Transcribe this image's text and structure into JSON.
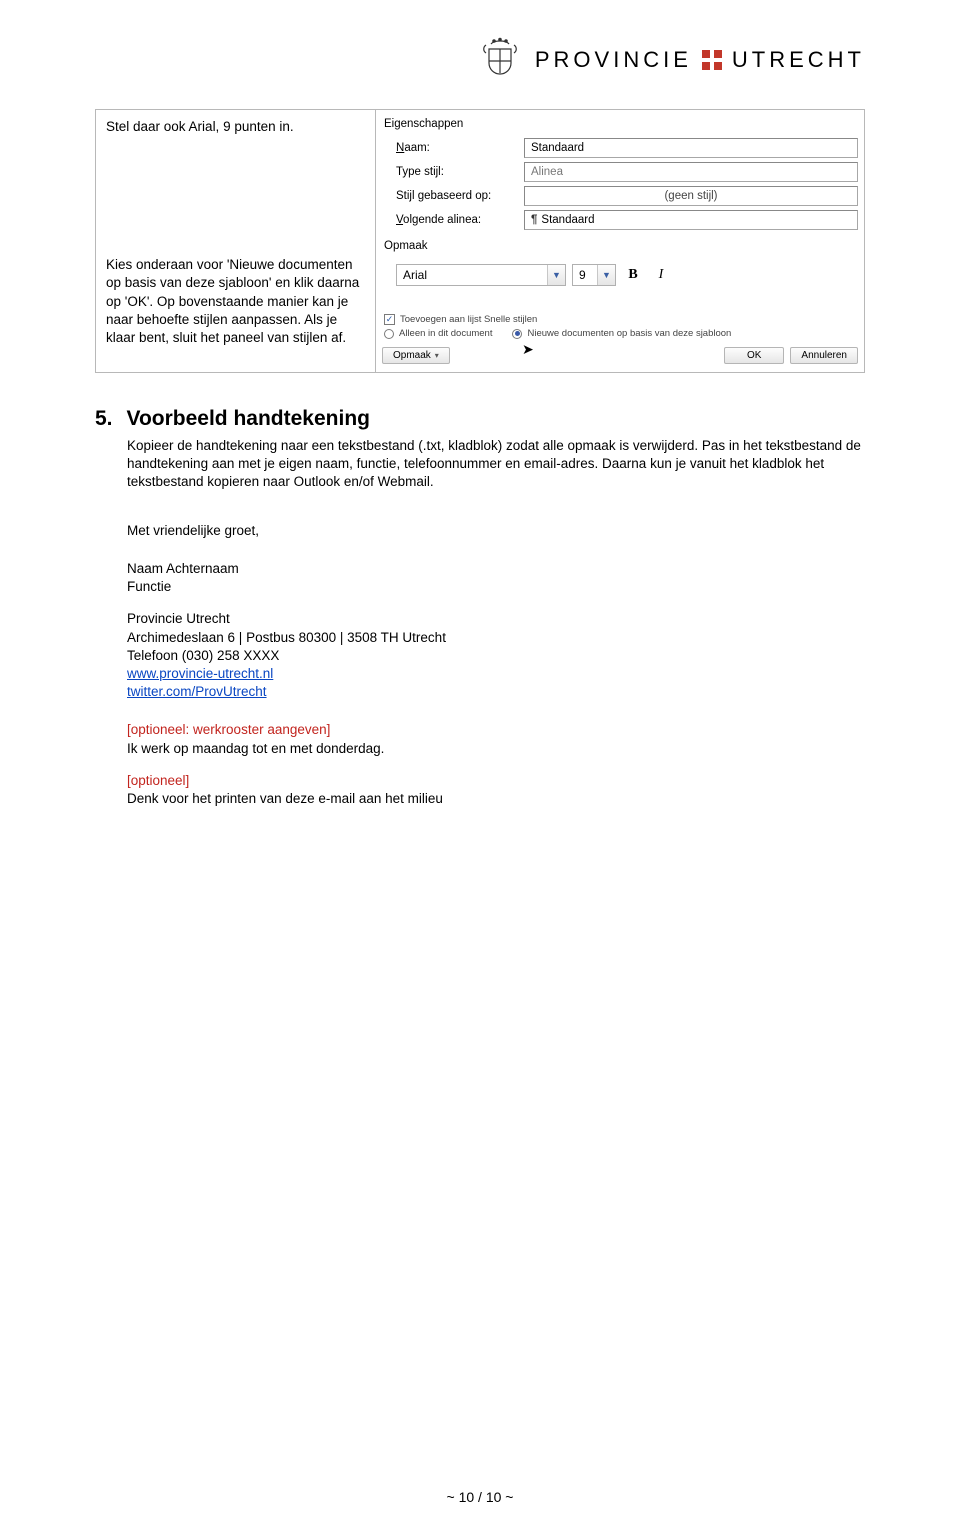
{
  "header": {
    "brand_1": "PROVINCIE",
    "brand_2": "UTRECHT"
  },
  "left": {
    "p1": "Stel daar ook Arial, 9 punten in.",
    "p2": "Kies onderaan voor 'Nieuwe documenten op basis van deze sjabloon' en klik daarna op 'OK'. Op bovenstaande manier kan je naar behoefte stijlen aanpassen. Als je klaar bent, sluit het paneel van stijlen af."
  },
  "dialog": {
    "group_props": "Eigenschappen",
    "lbl_name": "Naam:",
    "val_name": "Standaard",
    "lbl_type": "Type stijl:",
    "val_type": "Alinea",
    "lbl_based": "Stijl gebaseerd op:",
    "val_based": "(geen stijl)",
    "lbl_next": "Volgende alinea:",
    "val_next": "Standaard",
    "group_format": "Opmaak",
    "font_name": "Arial",
    "font_size": "9",
    "bold": "B",
    "italic": "I",
    "chk_quickstyles": "Toevoegen aan lijst Snelle stijlen",
    "radio_thisdoc": "Alleen in dit document",
    "radio_newdocs": "Nieuwe documenten op basis van deze sjabloon",
    "btn_format": "Opmaak",
    "btn_ok": "OK",
    "btn_cancel": "Annuleren"
  },
  "section5": {
    "num": "5.",
    "title": "Voorbeeld handtekening",
    "body": "Kopieer de handtekening naar een tekstbestand (.txt, kladblok) zodat alle opmaak is verwijderd. Pas in het tekstbestand de handtekening aan met je eigen naam, functie, telefoonnummer en email-adres. Daarna kun je vanuit het kladblok het tekstbestand kopieren naar Outlook en/of Webmail."
  },
  "signature": {
    "greeting": "Met vriendelijke groet,",
    "name": "Naam Achternaam",
    "func": "Functie",
    "org": "Provincie Utrecht",
    "addr": "Archimedeslaan 6 | Postbus 80300 | 3508 TH Utrecht",
    "tel": "Telefoon (030) 258 XXXX",
    "site": "www.provincie-utrecht.nl",
    "twitter": "twitter.com/ProvUtrecht",
    "opt1": "[optioneel: werkrooster aangeven]",
    "opt1b": "Ik werk op maandag tot en met donderdag.",
    "opt2": "[optioneel]",
    "opt2b": "Denk voor het printen van deze e-mail aan het milieu"
  },
  "footer": "~ 10 / 10 ~"
}
